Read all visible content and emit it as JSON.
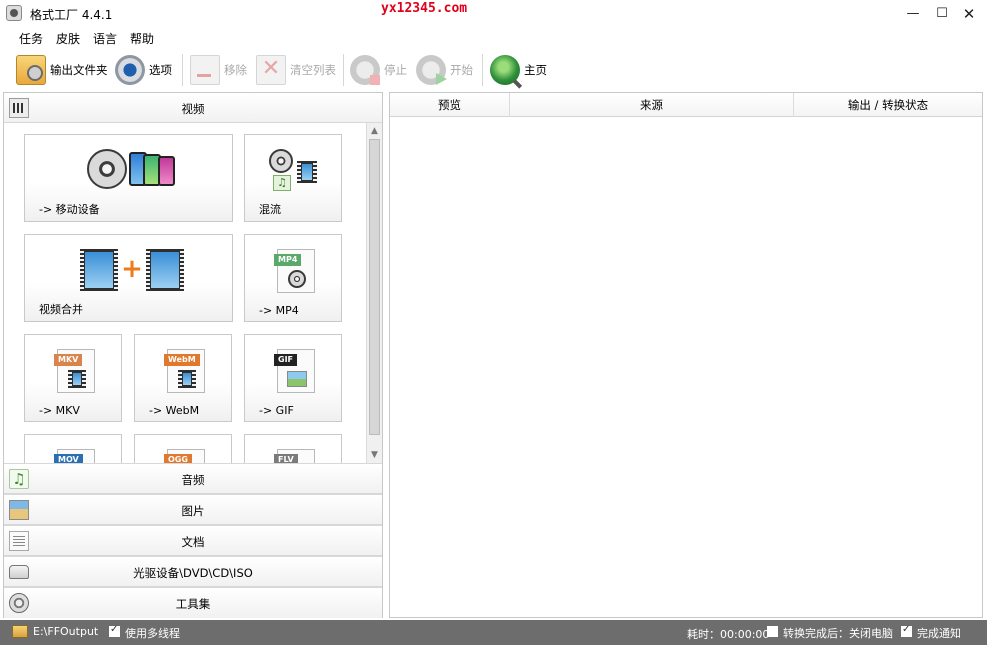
{
  "window": {
    "title": "格式工厂 4.4.1",
    "watermark": "yx12345.com",
    "controls": {
      "minimize": "—",
      "maximize": "☐",
      "close": "✕"
    }
  },
  "menu": {
    "items": [
      "任务",
      "皮肤",
      "语言",
      "帮助"
    ]
  },
  "toolbar": {
    "output_folder": "输出文件夹",
    "options": "选项",
    "remove": "移除",
    "clear_list": "清空列表",
    "stop": "停止",
    "start": "开始",
    "home": "主页"
  },
  "categories": {
    "video": "视频",
    "audio": "音频",
    "image": "图片",
    "document": "文档",
    "rom": "光驱设备\\DVD\\CD\\ISO",
    "tools": "工具集"
  },
  "video_tiles": [
    {
      "label": "-> 移动设备"
    },
    {
      "label": "混流"
    },
    {
      "label": "视频合并"
    },
    {
      "label": "-> MP4",
      "badge": "MP4"
    },
    {
      "label": "-> MKV",
      "badge": "MKV"
    },
    {
      "label": "-> WebM",
      "badge": "WebM"
    },
    {
      "label": "-> GIF",
      "badge": "GIF"
    },
    {
      "label": "",
      "badge": "MOV"
    },
    {
      "label": "",
      "badge": "OGG"
    },
    {
      "label": "",
      "badge": "FLV"
    }
  ],
  "task_list": {
    "columns": [
      "预览",
      "来源",
      "输出 / 转换状态"
    ]
  },
  "statusbar": {
    "output_path": "E:\\FFOutput",
    "multithread_label": "使用多线程",
    "multithread_checked": true,
    "elapsed": "耗时：00:00:00",
    "shutdown_label": "转换完成后：关闭电脑",
    "shutdown_checked": false,
    "notify_label": "完成通知",
    "notify_checked": true
  },
  "colors": {
    "watermark": "#e0001b",
    "statusbar_bg": "#6d6d6d",
    "badge_mp4": "#5aa86a",
    "badge_mkv": "#d9844a",
    "badge_webm": "#e0782e",
    "badge_gif": "#222222",
    "badge_mov": "#2a6fb1",
    "badge_ogg": "#e0782e",
    "badge_flv": "#7a7a7a"
  }
}
